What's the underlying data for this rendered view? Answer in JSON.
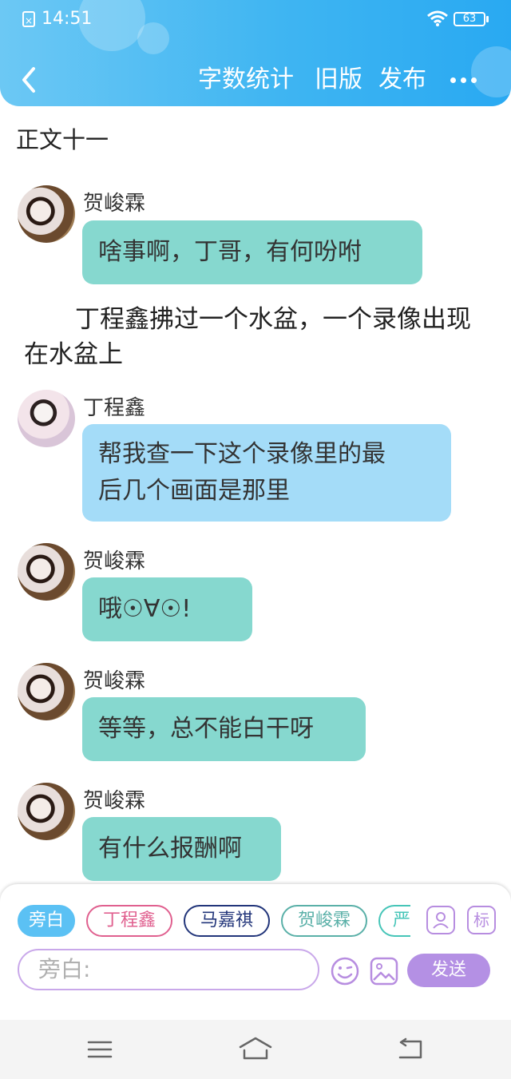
{
  "status_bar": {
    "time": "14:51",
    "battery": "63"
  },
  "toolbar": {
    "word_count": "字数统计",
    "old_version": "旧版",
    "publish": "发布"
  },
  "chapter_title": "正文十一",
  "messages": [
    {
      "speaker": "贺峻霖",
      "text": "啥事啊，丁哥，有何吩咐"
    },
    {
      "speaker": "丁程鑫",
      "text_line1": "帮我查一下这个录像里的最",
      "text_line2": "后几个画面是那里"
    },
    {
      "speaker": "贺峻霖",
      "text": "哦☉∀☉!"
    },
    {
      "speaker": "贺峻霖",
      "text": "等等，总不能白干呀"
    },
    {
      "speaker": "贺峻霖",
      "text": "有什么报酬啊"
    }
  ],
  "narration": "丁程鑫拂过一个水盆，一个录像出现在水盆上",
  "composer": {
    "roles": [
      "旁白",
      "丁程鑫",
      "马嘉祺",
      "贺峻霖",
      "严"
    ],
    "tag_button": "标",
    "input_placeholder": "旁白:",
    "send": "发送"
  },
  "colors": {
    "header": "#3fb5f2",
    "teal_bubble": "#86d8cf",
    "blue_bubble": "#a4dcf8",
    "send": "#b490e4"
  },
  "icons": [
    "close-box-icon",
    "wifi-icon",
    "battery-icon",
    "back-arrow-icon",
    "more-icon",
    "portrait-icon",
    "emoji-icon",
    "image-icon",
    "menu-icon",
    "home-icon",
    "return-icon"
  ]
}
